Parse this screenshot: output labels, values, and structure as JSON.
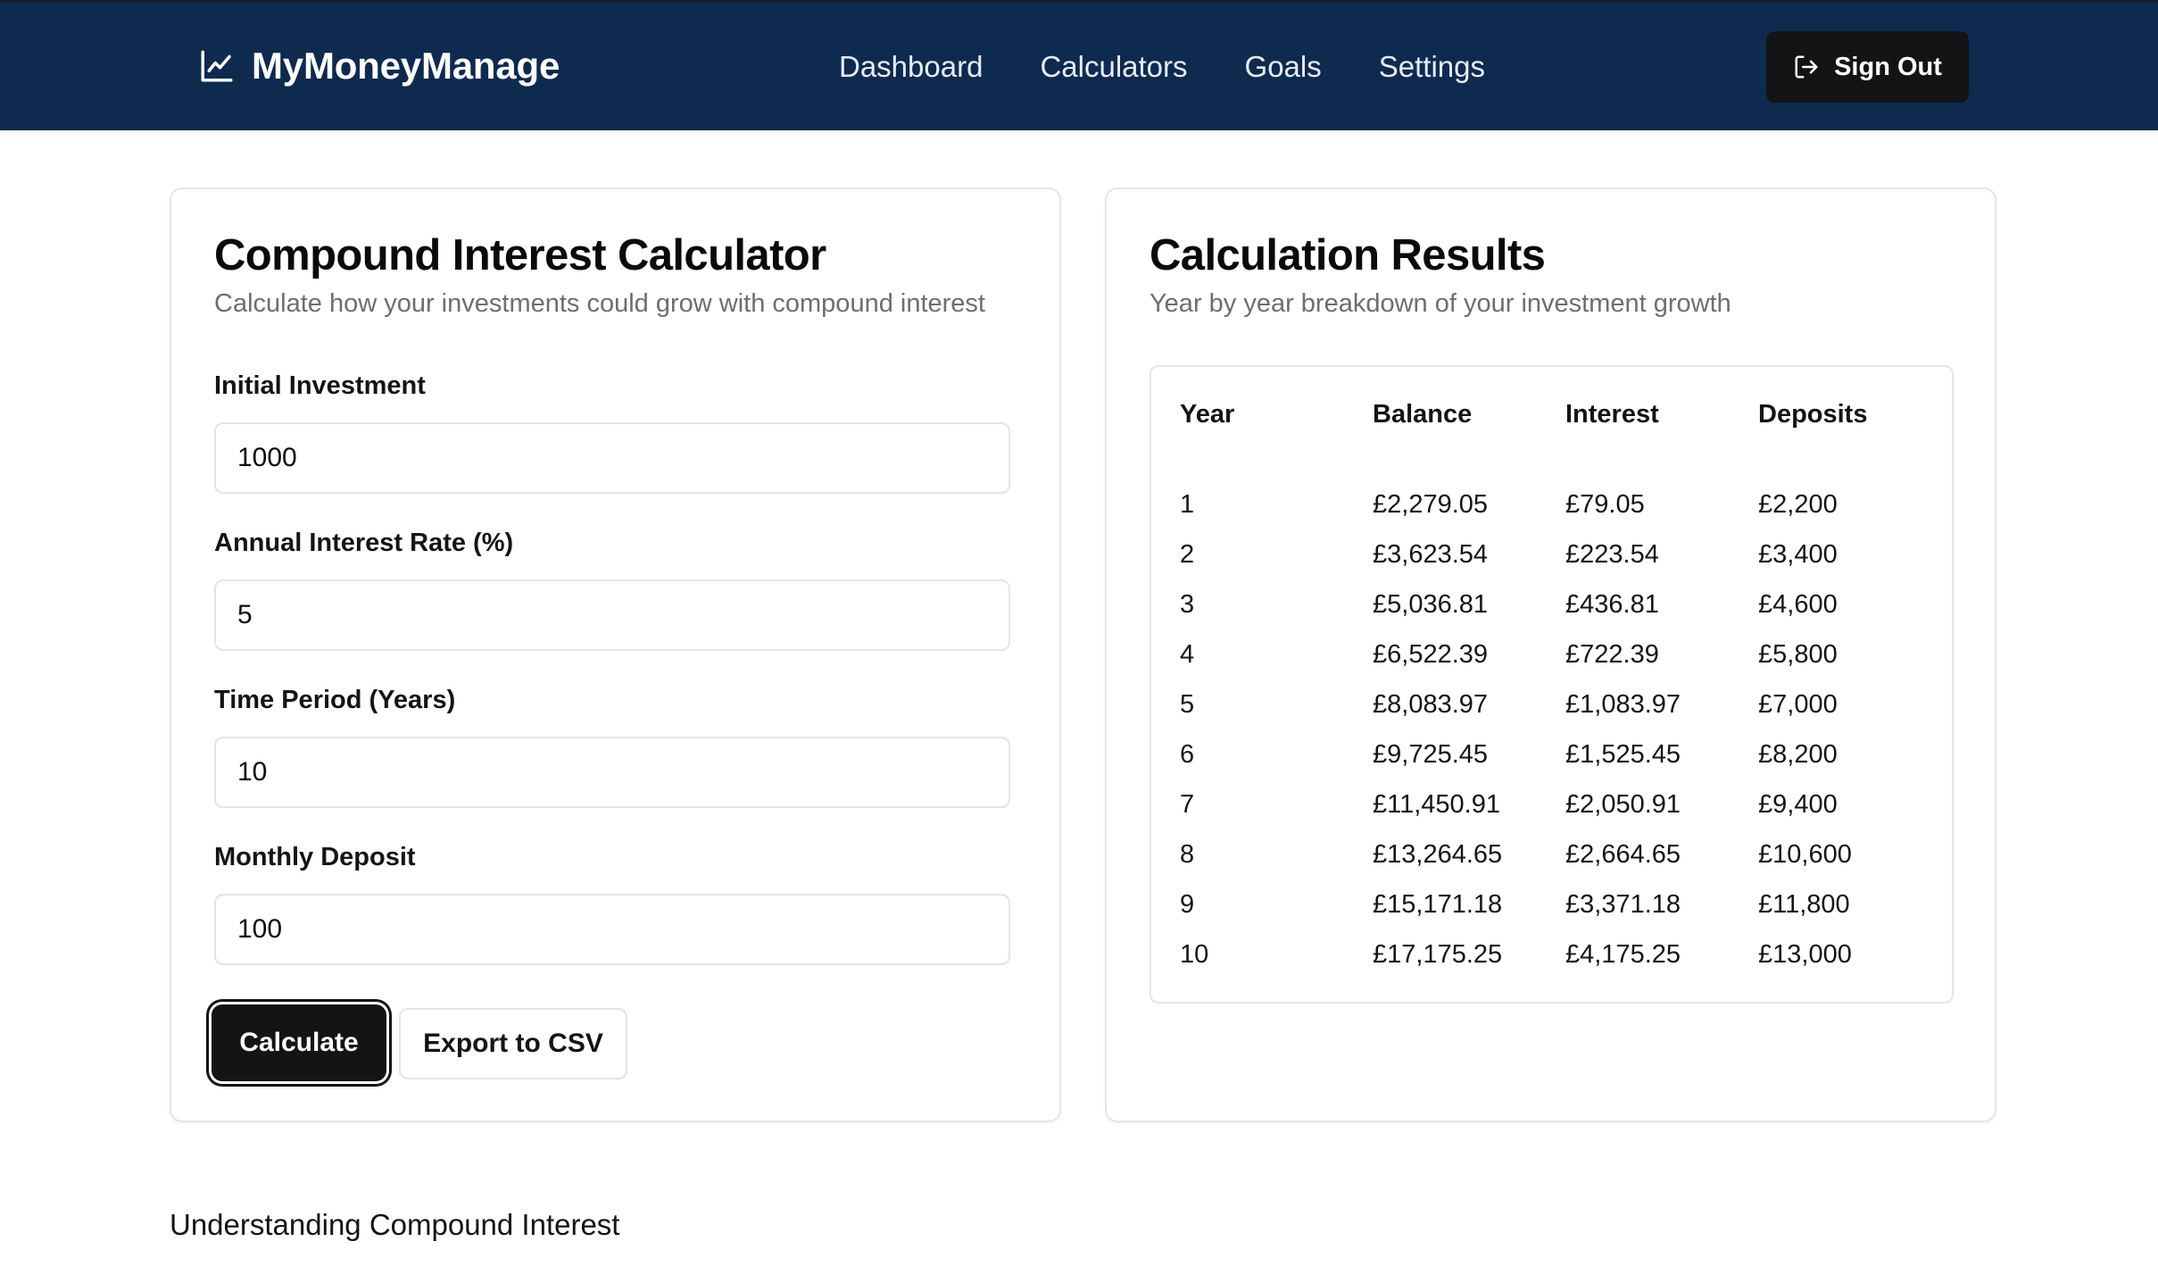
{
  "app": {
    "name": "MyMoneyManage"
  },
  "nav": {
    "links": [
      {
        "label": "Dashboard"
      },
      {
        "label": "Calculators"
      },
      {
        "label": "Goals"
      },
      {
        "label": "Settings"
      }
    ],
    "sign_out_label": "Sign Out"
  },
  "calculator": {
    "title": "Compound Interest Calculator",
    "subtitle": "Calculate how your investments could grow with compound interest",
    "fields": {
      "initial_investment": {
        "label": "Initial Investment",
        "value": "1000"
      },
      "annual_rate": {
        "label": "Annual Interest Rate (%)",
        "value": "5"
      },
      "time_period": {
        "label": "Time Period (Years)",
        "value": "10"
      },
      "monthly_deposit": {
        "label": "Monthly Deposit",
        "value": "100"
      }
    },
    "calculate_label": "Calculate",
    "export_label": "Export to CSV"
  },
  "results": {
    "title": "Calculation Results",
    "subtitle": "Year by year breakdown of your investment growth",
    "columns": [
      "Year",
      "Balance",
      "Interest",
      "Deposits"
    ],
    "rows": [
      [
        "1",
        "£2,279.05",
        "£79.05",
        "£2,200"
      ],
      [
        "2",
        "£3,623.54",
        "£223.54",
        "£3,400"
      ],
      [
        "3",
        "£5,036.81",
        "£436.81",
        "£4,600"
      ],
      [
        "4",
        "£6,522.39",
        "£722.39",
        "£5,800"
      ],
      [
        "5",
        "£8,083.97",
        "£1,083.97",
        "£7,000"
      ],
      [
        "6",
        "£9,725.45",
        "£1,525.45",
        "£8,200"
      ],
      [
        "7",
        "£11,450.91",
        "£2,050.91",
        "£9,400"
      ],
      [
        "8",
        "£13,264.65",
        "£2,664.65",
        "£10,600"
      ],
      [
        "9",
        "£15,171.18",
        "£3,371.18",
        "£11,800"
      ],
      [
        "10",
        "£17,175.25",
        "£4,175.25",
        "£13,000"
      ]
    ]
  },
  "footer": {
    "heading": "Understanding Compound Interest"
  },
  "colors": {
    "navbar_bg": "#0f2a4f",
    "button_dark": "#141414",
    "muted_text": "#6e6e6e",
    "border": "#e6e6e6"
  },
  "icons": {
    "brand": "line-chart-icon",
    "sign_out": "log-out-icon"
  }
}
